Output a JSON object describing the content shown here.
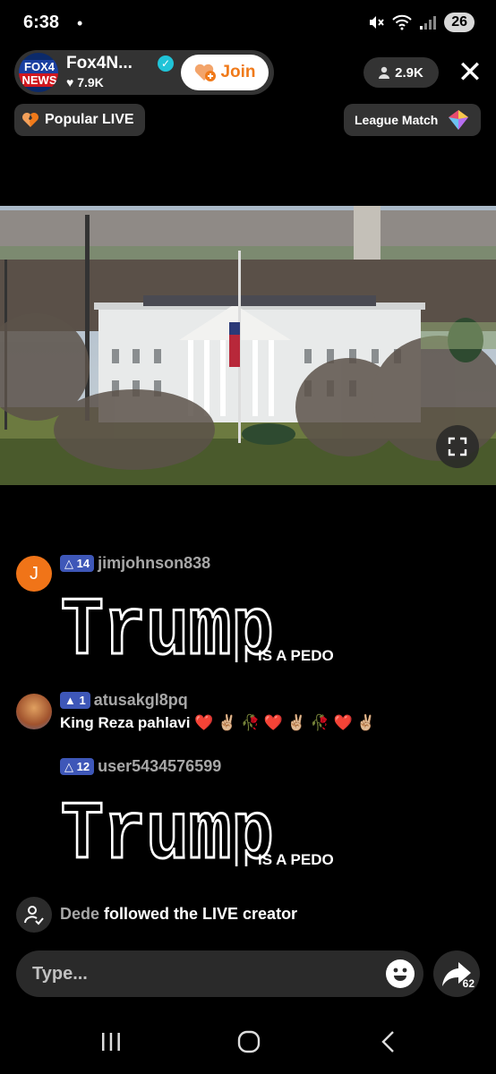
{
  "status_bar": {
    "time": "6:38",
    "dot": "•",
    "battery": "26"
  },
  "host": {
    "name": "Fox4N...",
    "likes": "7.9K",
    "join_label": "Join",
    "logo_line1": "FOX4",
    "logo_line2": "NEWS"
  },
  "viewers": {
    "count": "2.9K"
  },
  "popular_live": {
    "label": "Popular LIVE"
  },
  "league_match": {
    "label": "League Match"
  },
  "chat": [
    {
      "level": "14",
      "username": "jimjohnson838",
      "avatar_letter": "J",
      "avatar_color": "#f07418",
      "art_text": "Trump",
      "suffix": "IS A PEDO"
    },
    {
      "level": "1",
      "username": "atusakgl8pq",
      "message": "King Reza pahlavi ❤️ ✌🏼 🥀 ❤️ ✌🏼 🥀 ❤️ ✌🏼"
    },
    {
      "level": "12",
      "username": "user5434576599",
      "art_text": "Trump",
      "suffix": "IS A PEDO"
    }
  ],
  "follow_event": {
    "user": "Dede",
    "text": "followed the LIVE creator"
  },
  "input": {
    "placeholder": "Type..."
  },
  "share": {
    "count": "62"
  },
  "colors": {
    "badge": "#3e57b8",
    "join_text": "#f07a1a",
    "accent": "#20c4d8"
  }
}
